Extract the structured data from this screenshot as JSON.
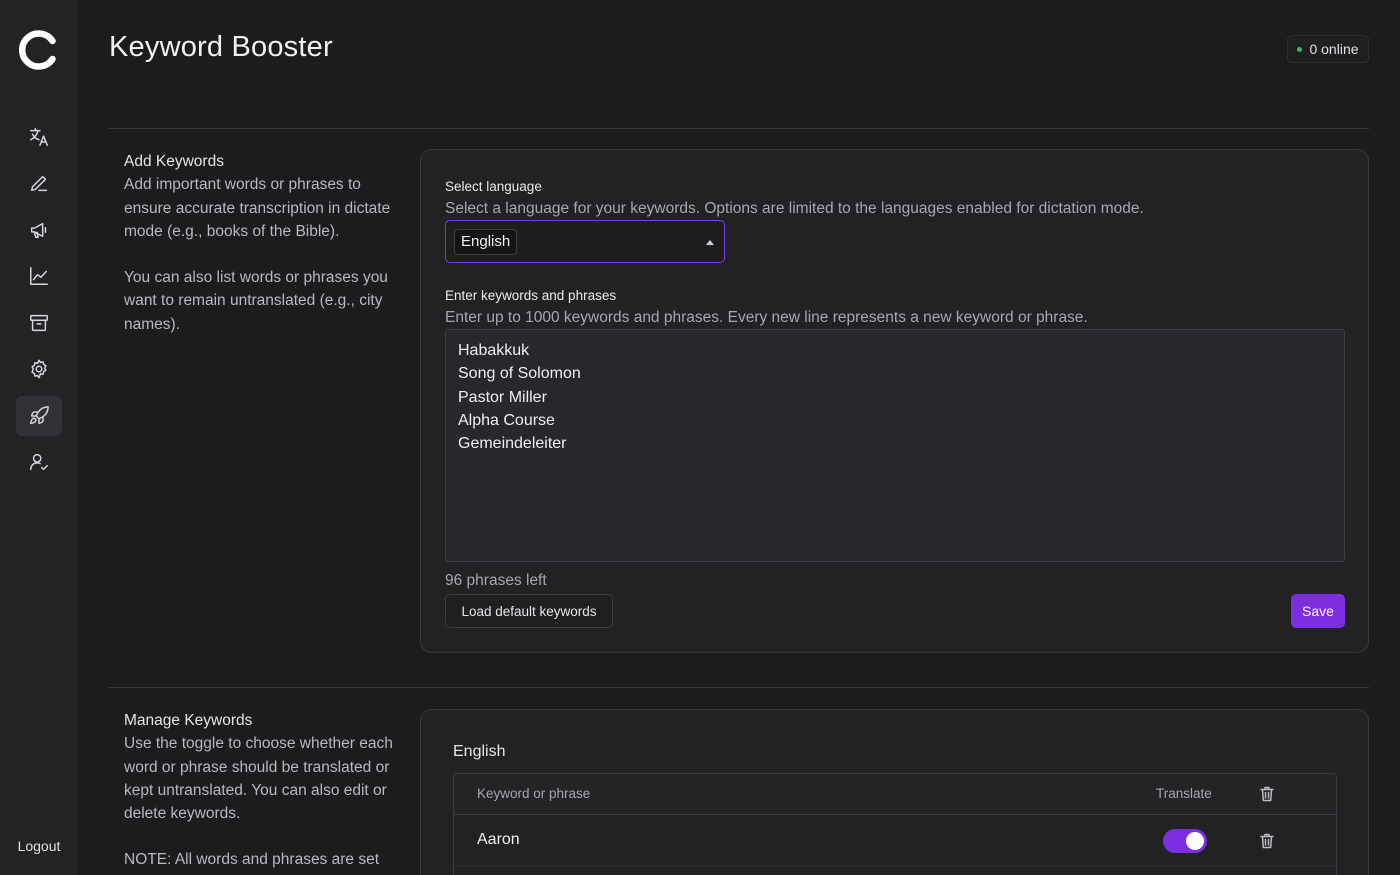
{
  "app": {
    "page_title": "Keyword Booster"
  },
  "status": {
    "online_text": "0 online",
    "online_color": "#3fb950"
  },
  "sidebar": {
    "items": [
      {
        "name": "translate",
        "icon": "translate-icon",
        "active": false
      },
      {
        "name": "edit",
        "icon": "pencil-icon",
        "active": false
      },
      {
        "name": "announcements",
        "icon": "megaphone-icon",
        "active": false
      },
      {
        "name": "analytics",
        "icon": "chart-line-icon",
        "active": false
      },
      {
        "name": "archive",
        "icon": "archive-icon",
        "active": false
      },
      {
        "name": "settings",
        "icon": "gear-icon",
        "active": false
      },
      {
        "name": "keyword-booster",
        "icon": "rocket-icon",
        "active": true
      },
      {
        "name": "users",
        "icon": "user-check-icon",
        "active": false
      }
    ],
    "logout_label": "Logout"
  },
  "add_section": {
    "title": "Add Keywords",
    "description_1": "Add important words or phrases to ensure accurate transcription in dictate mode (e.g., books of the Bible).",
    "description_2": "You can also list words or phrases you want to remain untranslated (e.g., city names).",
    "select_label": "Select language",
    "select_help": "Select a language for your keywords. Options are limited to the languages enabled for dictation mode.",
    "selected_language": "English",
    "keywords_label": "Enter keywords and phrases",
    "keywords_help": "Enter up to 1000 keywords and phrases. Every new line represents a new keyword or phrase.",
    "keywords": [
      "Habakkuk",
      "Song of Solomon",
      "Pastor Miller",
      "Alpha Course",
      "Gemeindeleiter"
    ],
    "phrases_left": "96 phrases left",
    "load_default_label": "Load default keywords",
    "save_label": "Save"
  },
  "manage_section": {
    "title": "Manage Keywords",
    "description_1": "Use the toggle to choose whether each word or phrase should be translated or kept untranslated. You can also edit or delete keywords.",
    "description_2": "NOTE: All words and phrases are set",
    "language_heading": "English",
    "table": {
      "col_keyword": "Keyword or phrase",
      "col_translate": "Translate",
      "rows": [
        {
          "keyword": "Aaron",
          "translate": true
        }
      ]
    }
  },
  "colors": {
    "accent": "#7c2ee0",
    "background": "#1c1c1f",
    "sidebar": "#232326"
  }
}
